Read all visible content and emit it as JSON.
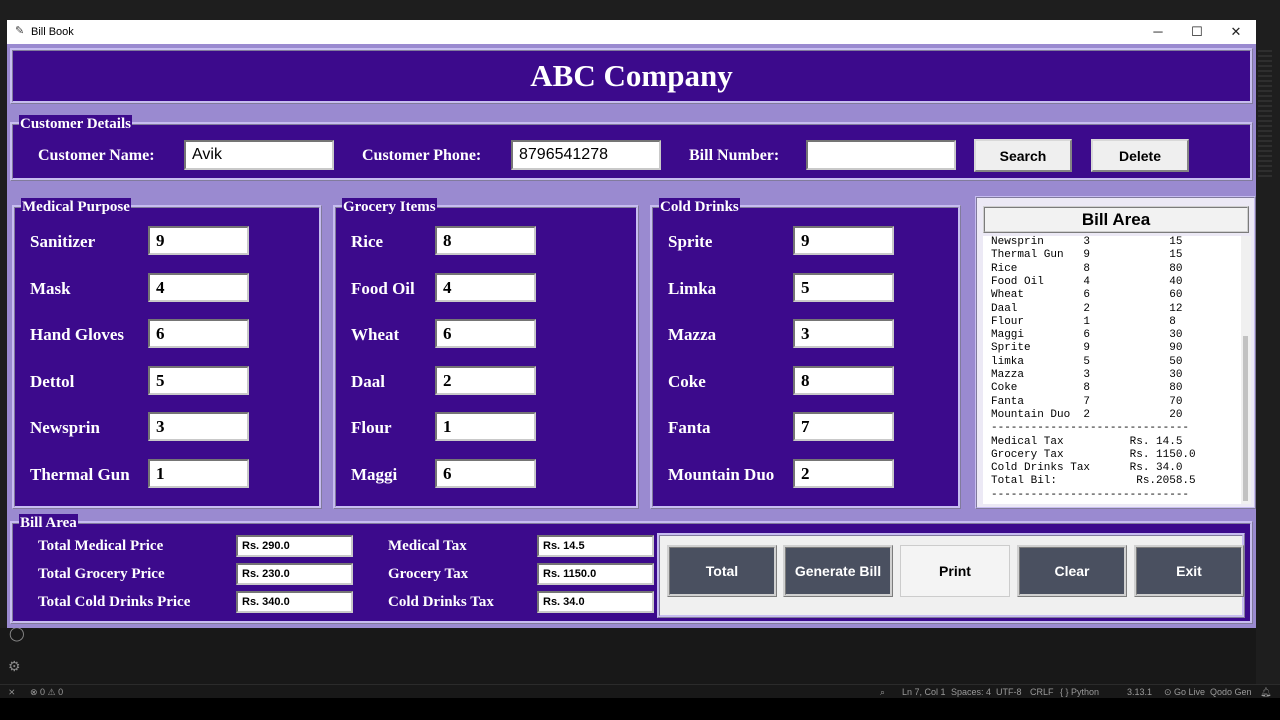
{
  "window": {
    "title": "Bill Book",
    "minimize": "─",
    "maximize": "☐",
    "close": "✕",
    "app_icon": "feather-icon"
  },
  "header": {
    "company": "ABC Company"
  },
  "customer": {
    "section_title": "Customer Details",
    "name_label": "Customer Name:",
    "name_value": "Avik",
    "phone_label": "Customer Phone:",
    "phone_value": "8796541278",
    "bill_label": "Bill Number:",
    "bill_value": "",
    "search_button": "Search",
    "delete_button": "Delete"
  },
  "medical": {
    "title": "Medical Purpose",
    "items": [
      {
        "label": "Sanitizer",
        "value": "9"
      },
      {
        "label": "Mask",
        "value": "4"
      },
      {
        "label": "Hand Gloves",
        "value": "6"
      },
      {
        "label": "Dettol",
        "value": "5"
      },
      {
        "label": "Newsprin",
        "value": "3"
      },
      {
        "label": "Thermal Gun",
        "value": "1"
      }
    ]
  },
  "grocery": {
    "title": "Grocery Items",
    "items": [
      {
        "label": "Rice",
        "value": "8"
      },
      {
        "label": "Food Oil",
        "value": "4"
      },
      {
        "label": "Wheat",
        "value": "6"
      },
      {
        "label": "Daal",
        "value": "2"
      },
      {
        "label": "Flour",
        "value": "1"
      },
      {
        "label": "Maggi",
        "value": "6"
      }
    ]
  },
  "drinks": {
    "title": "Cold Drinks",
    "items": [
      {
        "label": "Sprite",
        "value": "9"
      },
      {
        "label": "Limka",
        "value": "5"
      },
      {
        "label": "Mazza",
        "value": "3"
      },
      {
        "label": "Coke",
        "value": "8"
      },
      {
        "label": "Fanta",
        "value": "7"
      },
      {
        "label": "Mountain Duo",
        "value": "2"
      }
    ]
  },
  "bill_area": {
    "title": "Bill Area",
    "lines": [
      "Newsprin      3            15",
      "Thermal Gun   9            15",
      "Rice          8            80",
      "Food Oil      4            40",
      "Wheat         6            60",
      "Daal          2            12",
      "Flour         1            8",
      "Maggi         6            30",
      "Sprite        9            90",
      "limka         5            50",
      "Mazza         3            30",
      "Coke          8            80",
      "Fanta         7            70",
      "Mountain Duo  2            20",
      "------------------------------",
      "Medical Tax          Rs. 14.5",
      "Grocery Tax          Rs. 1150.0",
      "Cold Drinks Tax      Rs. 34.0",
      "Total Bil:            Rs.2058.5",
      "------------------------------"
    ]
  },
  "totals": {
    "title": "Bill Area",
    "medical_price_label": "Total Medical Price",
    "medical_price": "Rs. 290.0",
    "grocery_price_label": "Total Grocery Price",
    "grocery_price": "Rs. 230.0",
    "drinks_price_label": "Total Cold Drinks Price",
    "drinks_price": "Rs. 340.0",
    "medical_tax_label": "Medical Tax",
    "medical_tax": "Rs. 14.5",
    "grocery_tax_label": "Grocery Tax",
    "grocery_tax": "Rs. 1150.0",
    "drinks_tax_label": "Cold Drinks Tax",
    "drinks_tax": "Rs. 34.0"
  },
  "actions": {
    "total": "Total",
    "generate": "Generate Bill",
    "print": "Print",
    "clear": "Clear",
    "exit": "Exit"
  },
  "statusbar": {
    "errors": "⊗ 0 ⚠ 0",
    "position": "Ln 7, Col 1",
    "spaces": "Spaces: 4",
    "encoding": "UTF-8",
    "eol": "CRLF",
    "language": "{ } Python",
    "version": "3.13.1",
    "golive": "⊙ Go Live",
    "qodo": "Qodo Gen"
  },
  "colors": {
    "panel": "#3c0a8c",
    "border": "#c7bdf0",
    "button_dark": "#4a5060"
  }
}
